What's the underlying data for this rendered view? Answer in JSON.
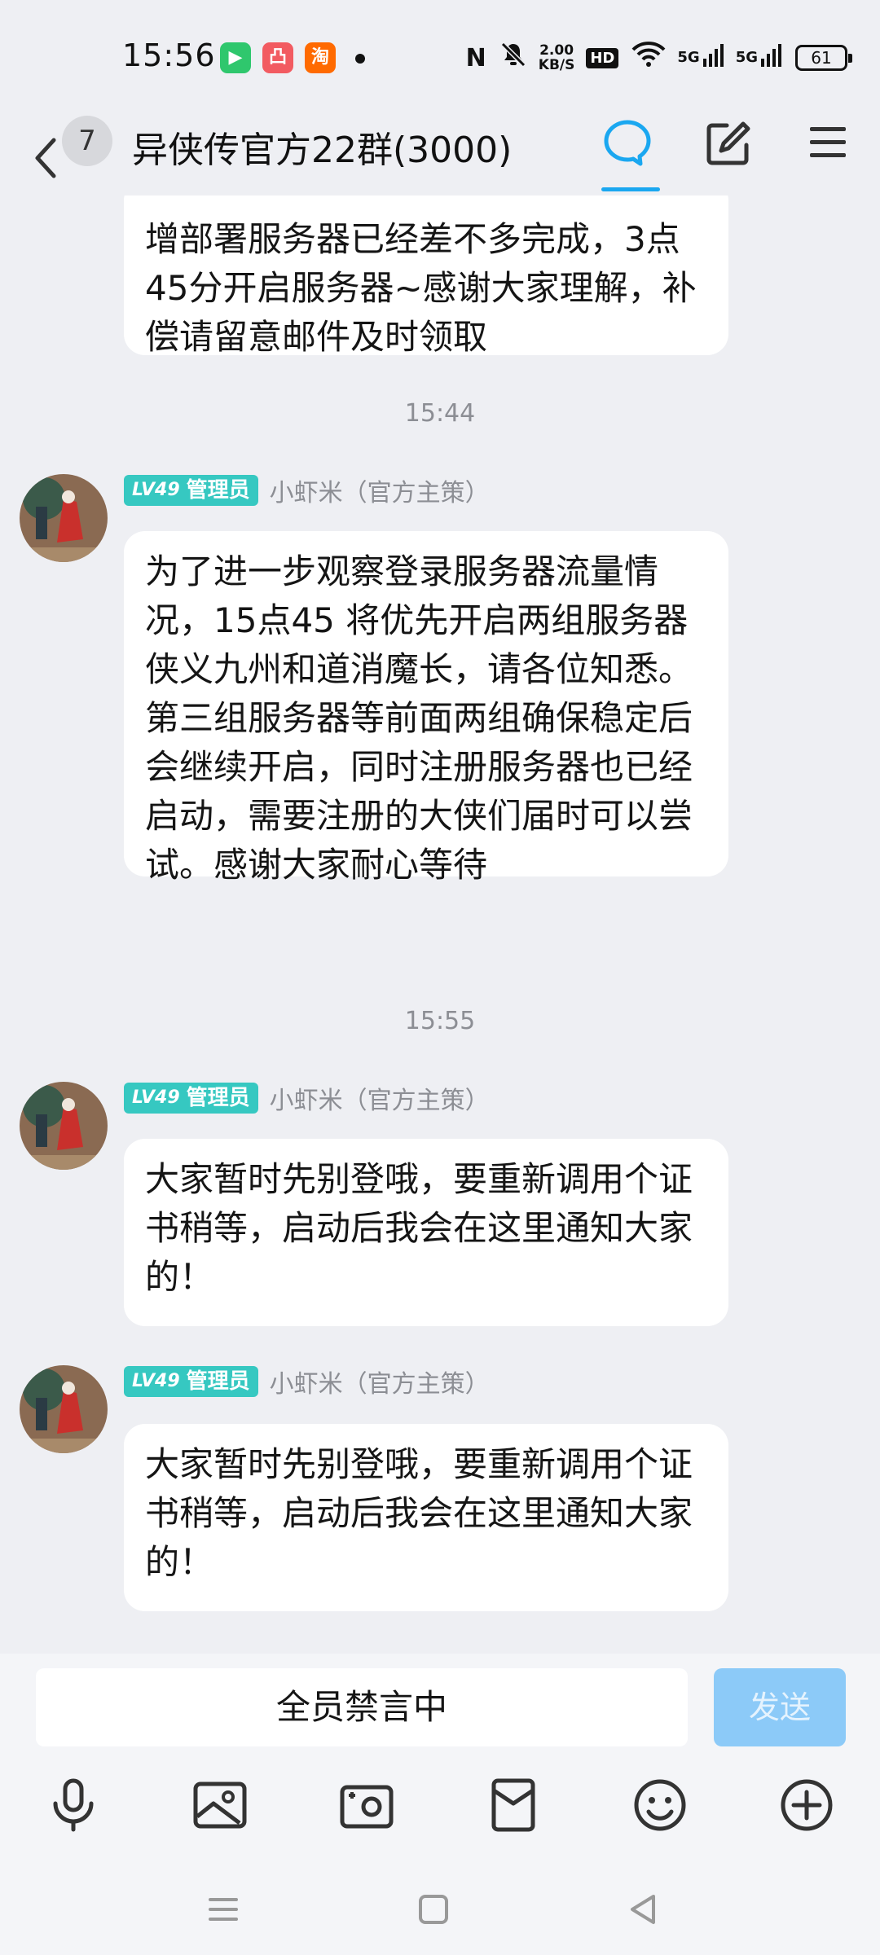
{
  "status_bar": {
    "time": "15:56",
    "app_icons": [
      {
        "name": "video-app-icon",
        "glyph": "▶",
        "color": "#2fc76d"
      },
      {
        "name": "photo-app-icon",
        "glyph": "凸",
        "color": "#f25b61"
      },
      {
        "name": "taobao-app-icon",
        "glyph": "淘",
        "color": "#ff6a00"
      }
    ],
    "nfc": "N",
    "speed_value": "2.00",
    "speed_unit": "KB/S",
    "hd_label": "HD",
    "network_1": "5G",
    "network_2": "5G",
    "battery": "61"
  },
  "header": {
    "unread_count": "7",
    "title": "异侠传官方22群(3000)"
  },
  "messages": [
    {
      "text": "增部署服务器已经差不多完成，3点45分开启服务器~感谢大家理解，补偿请留意邮件及时领取"
    },
    {
      "timestamp": "15:44",
      "level": "LV49",
      "role": "管理员",
      "sender": "小虾米（官方主策）",
      "text": "为了进一步观察登录服务器流量情况，15点45 将优先开启两组服务器 侠义九州和道消魔长，请各位知悉。第三组服务器等前面两组确保稳定后会继续开启，同时注册服务器也已经启动，需要注册的大侠们届时可以尝试。感谢大家耐心等待"
    },
    {
      "timestamp": "15:55",
      "level": "LV49",
      "role": "管理员",
      "sender": "小虾米（官方主策）",
      "text": "大家暂时先别登哦，要重新调用个证书稍等，启动后我会在这里通知大家的！"
    },
    {
      "level": "LV49",
      "role": "管理员",
      "sender": "小虾米（官方主策）",
      "text": "大家暂时先别登哦，要重新调用个证书稍等，启动后我会在这里通知大家的！"
    }
  ],
  "input": {
    "muted_text": "全员禁言中",
    "send_label": "发送"
  },
  "toolbar_icons": [
    "microphone-icon",
    "image-icon",
    "camera-icon",
    "red-packet-icon",
    "emoji-icon",
    "plus-icon"
  ],
  "colors": {
    "accent": "#1aa7f0",
    "level_badge": "#36c8c1",
    "send_disabled": "#8ccaf8",
    "background": "#eeeff3"
  }
}
